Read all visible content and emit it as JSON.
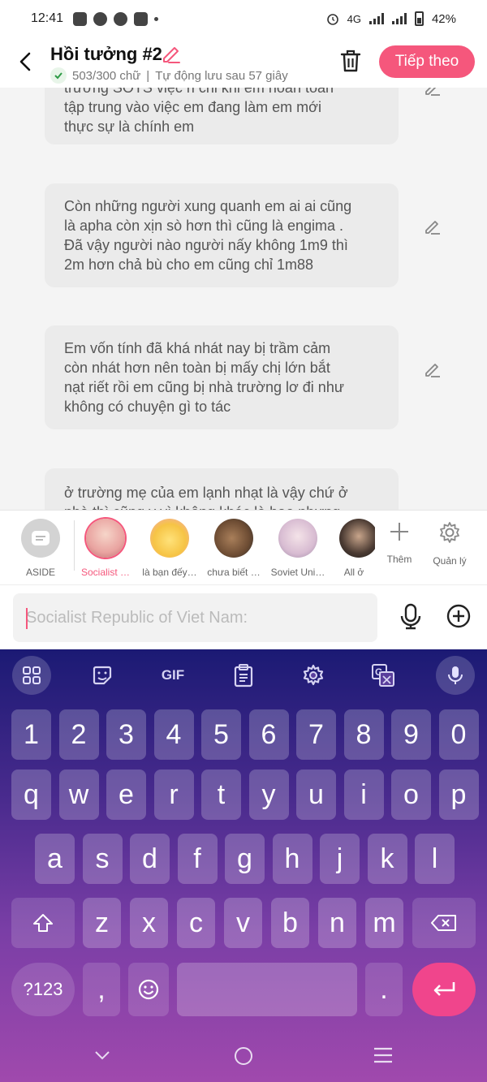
{
  "status_bar": {
    "time": "12:41",
    "network": "4G",
    "battery": "42%",
    "apps": [
      "zalo-icon",
      "messenger-icon",
      "chat-icon",
      "instagram-icon"
    ]
  },
  "header": {
    "title": "Hồi tưởng #2",
    "word_count": "503/300 chữ",
    "autosave": "Tự động lưu sau 57 giây",
    "next_label": "Tiếp theo",
    "accent": "#f5577c"
  },
  "cards": [
    {
      "text": "trường… tập trung vào việc em đang làm em mới thực sự là chính em",
      "lines": [
        "trường SOTS việc ri chi khi em hoàn toàn",
        "tập trung vào việc em đang làm em mới",
        "thực sự là chính em"
      ]
    },
    {
      "lines": [
        "Còn những người xung quanh em ai ai cũng",
        "là apha còn xịn sò hơn thì cũng là engima .",
        "Đã vậy người nào người nấy không 1m9 thì",
        "2m hơn chả bù cho em cũng chỉ 1m88"
      ]
    },
    {
      "lines": [
        "Em vốn tính đã khá nhát nay bị trầm cảm",
        "còn nhát hơn nên toàn bị mấy chị lớn bắt",
        "nạt riết rồi em cũng bị nhà trường lơ đi như",
        "không có chuyện gì to tác"
      ]
    },
    {
      "lines": [
        "ở trường mẹ của em lạnh nhạt là vậy chứ ở",
        "nhà thì cũng y vì không khác là bao nhưng"
      ]
    }
  ],
  "characters": [
    {
      "label": "ASIDE",
      "color": "#cfcfcf"
    },
    {
      "label": "Socialist …",
      "color": "#f2b8b4",
      "selected": true
    },
    {
      "label": "là bạn đếy…",
      "color": "#f5d36a"
    },
    {
      "label": "chưa biết …",
      "color": "#7a5a3c"
    },
    {
      "label": "Soviet Uni…",
      "color": "#d9c2d6"
    },
    {
      "label": "All ở",
      "color": "#3a2f2a"
    }
  ],
  "tools": {
    "add_label": "Thêm",
    "manage_label": "Quản lý"
  },
  "input": {
    "placeholder": "Socialist Republic of Viet Nam:"
  },
  "keyboard": {
    "toolbar": [
      "apps-icon",
      "sticker-icon",
      "GIF",
      "clipboard-icon",
      "settings-icon",
      "translate-icon",
      "mic-icon"
    ],
    "gif_label": "GIF",
    "row_numbers": [
      "1",
      "2",
      "3",
      "4",
      "5",
      "6",
      "7",
      "8",
      "9",
      "0"
    ],
    "row_q": [
      "q",
      "w",
      "e",
      "r",
      "t",
      "y",
      "u",
      "i",
      "o",
      "p"
    ],
    "row_a": [
      "a",
      "s",
      "d",
      "f",
      "g",
      "h",
      "j",
      "k",
      "l"
    ],
    "row_z": [
      "z",
      "x",
      "c",
      "v",
      "b",
      "n",
      "m"
    ],
    "symbols_label": "?123",
    "comma": ",",
    "period": "."
  }
}
